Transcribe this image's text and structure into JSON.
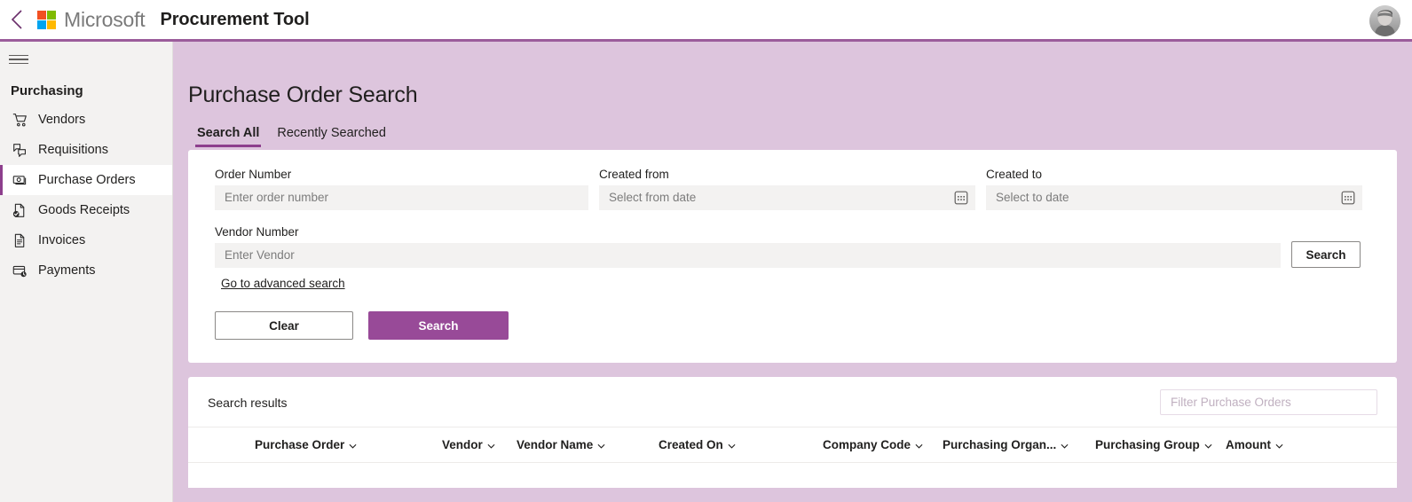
{
  "topbar": {
    "back_icon": "chevron-left-icon",
    "brand": "Microsoft",
    "app_title": "Procurement Tool",
    "avatar_alt": "user-avatar"
  },
  "sidebar": {
    "menu_icon": "hamburger-menu-icon",
    "title": "Purchasing",
    "items": [
      {
        "label": "Vendors",
        "icon": "shopping-cart-icon",
        "active": false
      },
      {
        "label": "Requisitions",
        "icon": "requisitions-icon",
        "active": false
      },
      {
        "label": "Purchase Orders",
        "icon": "money-bill-icon",
        "active": true
      },
      {
        "label": "Goods Receipts",
        "icon": "document-check-icon",
        "active": false
      },
      {
        "label": "Invoices",
        "icon": "invoice-document-icon",
        "active": false
      },
      {
        "label": "Payments",
        "icon": "card-clock-icon",
        "active": false
      }
    ]
  },
  "main": {
    "page_title": "Purchase Order Search",
    "tabs": [
      {
        "label": "Search All",
        "active": true
      },
      {
        "label": "Recently Searched",
        "active": false
      }
    ],
    "search_form": {
      "order_number": {
        "label": "Order Number",
        "placeholder": "Enter order number",
        "value": ""
      },
      "created_from": {
        "label": "Created from",
        "placeholder": "Select from date",
        "value": "",
        "icon": "calendar-icon"
      },
      "created_to": {
        "label": "Created to",
        "placeholder": "Select to date",
        "value": "",
        "icon": "calendar-icon"
      },
      "vendor_number": {
        "label": "Vendor Number",
        "placeholder": "Enter Vendor",
        "value": ""
      },
      "inline_search_label": "Search",
      "advanced_link": "Go to advanced search",
      "clear_label": "Clear",
      "submit_label": "Search"
    },
    "results": {
      "title": "Search results",
      "filter_placeholder": "Filter Purchase Orders",
      "filter_value": "",
      "columns": [
        "Purchase Order",
        "Vendor",
        "Vendor Name",
        "Created On",
        "Company Code",
        "Purchasing Organ...",
        "Purchasing Group",
        "Amount"
      ],
      "rows": []
    }
  },
  "colors": {
    "accent": "#984a98",
    "accent_dark": "#8d3f8d",
    "main_bg": "#ddc5dd",
    "sidebar_bg": "#f3f2f1",
    "input_bg": "#f3f2f1"
  }
}
